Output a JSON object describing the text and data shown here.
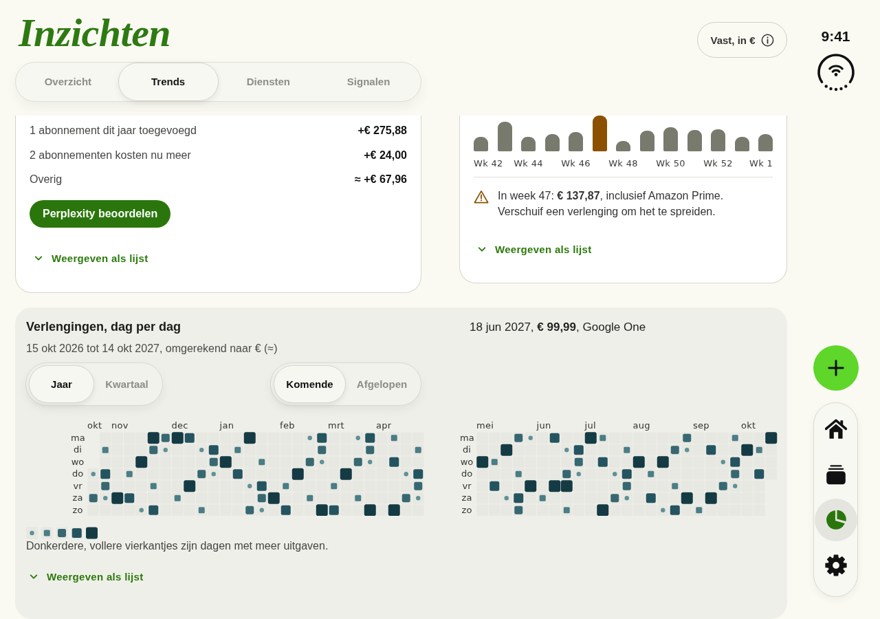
{
  "header": {
    "title": "Inzichten",
    "currency_button": {
      "label": "Vast, in €"
    }
  },
  "status": {
    "time": "9:41"
  },
  "tabs": [
    {
      "label": "Overzicht",
      "selected": false
    },
    {
      "label": "Trends",
      "selected": true
    },
    {
      "label": "Diensten",
      "selected": false
    },
    {
      "label": "Signalen",
      "selected": false
    }
  ],
  "changes_card": {
    "rows": [
      {
        "label": "1 abonnement dit jaar toegevoegd",
        "value": "+€ 275,88"
      },
      {
        "label": "2 abonnementen kosten nu meer",
        "value": "+€ 24,00"
      },
      {
        "label": "Overig",
        "value": "≈ +€ 67,96"
      }
    ],
    "action_button": "Perplexity beoordelen",
    "list_link": "Weergeven als lijst"
  },
  "weekly_card": {
    "bars": [
      {
        "highlighted": false
      },
      {
        "highlighted": false
      },
      {
        "highlighted": false
      },
      {
        "highlighted": false
      },
      {
        "highlighted": false
      },
      {
        "highlighted": true
      },
      {
        "highlighted": false
      },
      {
        "highlighted": false
      },
      {
        "highlighted": false
      },
      {
        "highlighted": false
      },
      {
        "highlighted": false
      },
      {
        "highlighted": false
      },
      {
        "highlighted": false
      }
    ],
    "week_labels": [
      "Wk 42",
      "Wk 44",
      "Wk 46",
      "Wk 48",
      "Wk 50",
      "Wk 52",
      "Wk 1"
    ],
    "warning": "In week 47: **€ 137,87**, inclusief Amazon Prime. Verschuif een verlenging om het te spreiden.",
    "list_link": "Weergeven als lijst"
  },
  "renewals_panel": {
    "title": "Verlengingen, dag per dag",
    "selected_day": "18 jun 2027, **€ 99,99**, Google One",
    "subtitle": "15 okt 2026 tot 14 okt 2027, omgerekend naar € (≈)",
    "period_toggle": [
      {
        "label": "Jaar",
        "selected": true
      },
      {
        "label": "Kwartaal",
        "selected": false
      }
    ],
    "direction_toggle": [
      {
        "label": "Komende",
        "selected": true
      },
      {
        "label": "Afgelopen",
        "selected": false
      }
    ],
    "calendar_halves": [
      {
        "months": [
          "okt",
          "nov",
          "dec",
          "jan",
          "feb",
          "mrt",
          "apr"
        ],
        "weekdays": [
          "ma",
          "di",
          "wo",
          "do",
          "vr",
          "za",
          "zo"
        ]
      },
      {
        "months": [
          "mei",
          "jun",
          "jul",
          "aug",
          "sep",
          "okt"
        ],
        "weekdays": [
          "ma",
          "di",
          "wo",
          "do",
          "vr",
          "za",
          "zo"
        ]
      }
    ],
    "legend_text": "Donkerdere, vollere vierkantjes zijn dagen met meer uitgaven.",
    "list_link": "Weergeven als lijst"
  },
  "nav": {
    "items": [
      {
        "selected": false
      },
      {
        "selected": false
      },
      {
        "selected": true
      },
      {
        "selected": false
      }
    ]
  }
}
